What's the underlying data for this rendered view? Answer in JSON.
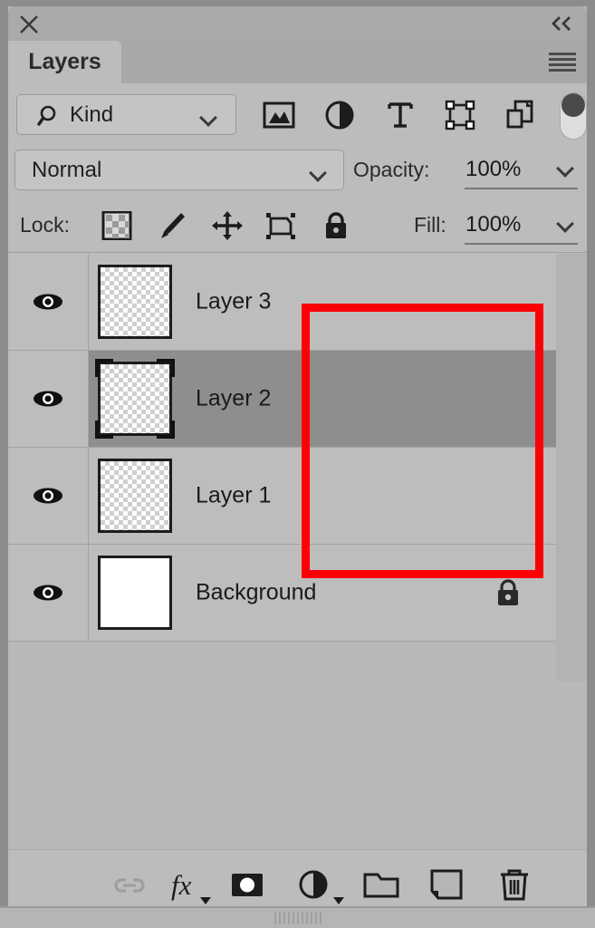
{
  "window": {
    "title": "Layers",
    "close_icon": "close-icon",
    "collapse_icon": "collapse-double-chevron-icon",
    "panel_menu_icon": "hamburger-menu-icon"
  },
  "filter_bar": {
    "search_icon": "magnifier-icon",
    "kind_label": "Kind",
    "kind_chevron_icon": "chevron-down-icon",
    "icons": [
      {
        "name": "filter-pixel-layers-icon",
        "label": "Pixel layers"
      },
      {
        "name": "filter-adjustment-layers-icon",
        "label": "Adjustment layers"
      },
      {
        "name": "filter-type-layers-icon",
        "label": "Type layers"
      },
      {
        "name": "filter-shape-layers-icon",
        "label": "Shape layers"
      },
      {
        "name": "filter-smart-objects-icon",
        "label": "Smart objects"
      }
    ],
    "toggle_icon": "filter-enable-toggle",
    "toggle_state": "off"
  },
  "blend_bar": {
    "blend_mode": "Normal",
    "blend_chevron_icon": "chevron-down-icon",
    "opacity_label": "Opacity:",
    "opacity_value": "100%",
    "opacity_chevron_icon": "chevron-down-icon"
  },
  "lock_bar": {
    "lock_label": "Lock:",
    "icons": [
      {
        "name": "lock-transparent-pixels-icon",
        "label": "Lock transparent pixels"
      },
      {
        "name": "lock-image-pixels-icon",
        "label": "Lock image pixels"
      },
      {
        "name": "lock-position-icon",
        "label": "Lock position"
      },
      {
        "name": "lock-artboard-nesting-icon",
        "label": "Prevent auto-nesting"
      },
      {
        "name": "lock-all-icon",
        "label": "Lock all"
      }
    ],
    "fill_label": "Fill:",
    "fill_value": "100%",
    "fill_chevron_icon": "chevron-down-icon"
  },
  "layers": [
    {
      "name": "Layer 3",
      "visible": true,
      "selected": false,
      "thumbnail": "transparent",
      "locked": false
    },
    {
      "name": "Layer 2",
      "visible": true,
      "selected": true,
      "thumbnail": "transparent",
      "locked": false
    },
    {
      "name": "Layer 1",
      "visible": true,
      "selected": false,
      "thumbnail": "transparent",
      "locked": false
    },
    {
      "name": "Background",
      "visible": true,
      "selected": false,
      "thumbnail": "white",
      "locked": true
    }
  ],
  "annotation": {
    "shape": "rectangle",
    "color": "#fb0007",
    "covers_layers": [
      "Layer 3",
      "Layer 2",
      "Layer 1"
    ]
  },
  "bottom_toolbar": {
    "buttons": [
      {
        "name": "link-layers-button",
        "label": "Link layers",
        "icon": "chain-link-icon",
        "disabled": true
      },
      {
        "name": "layer-style-button",
        "label": "Add a layer style",
        "icon": "fx-icon",
        "has_menu": true
      },
      {
        "name": "layer-mask-button",
        "label": "Add layer mask",
        "icon": "mask-icon",
        "has_menu": false
      },
      {
        "name": "adjustment-layer-button",
        "label": "New adjustment layer",
        "icon": "half-circle-icon",
        "has_menu": true
      },
      {
        "name": "new-group-button",
        "label": "Create a new group",
        "icon": "folder-icon",
        "has_menu": false
      },
      {
        "name": "new-layer-button",
        "label": "Create a new layer",
        "icon": "new-page-icon",
        "has_menu": false
      },
      {
        "name": "delete-layer-button",
        "label": "Delete layer",
        "icon": "trash-icon",
        "has_menu": false
      }
    ]
  },
  "colors": {
    "panel_bg": "#bcbcbc",
    "outer_bg": "#8c8c8c",
    "row_bg": "#bdbdbd",
    "row_selected_bg": "#8e8e8e",
    "annotation_red": "#fb0007",
    "text": "#1a1a1a"
  }
}
